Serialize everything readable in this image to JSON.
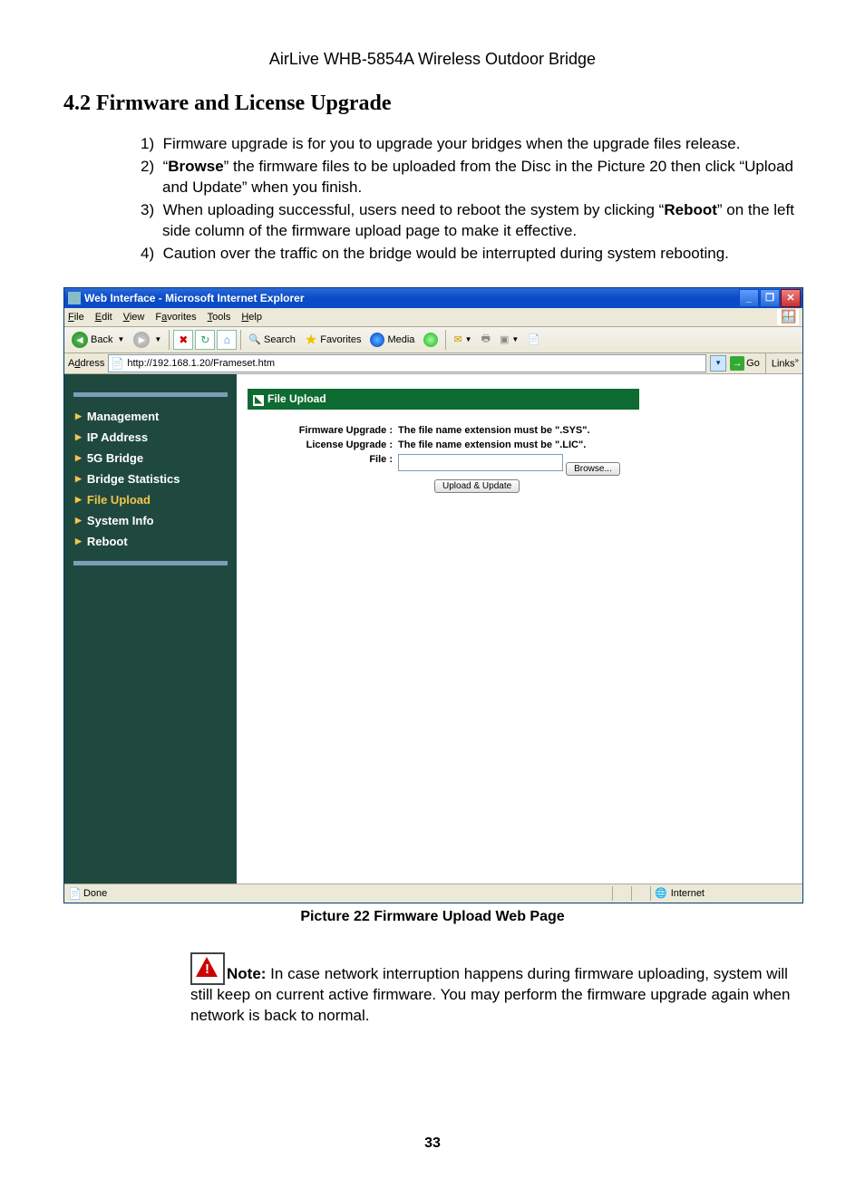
{
  "doc": {
    "header": "AirLive WHB-5854A Wireless Outdoor Bridge",
    "section_title": "4.2 Firmware and License Upgrade",
    "steps": [
      "Firmware upgrade is for you to upgrade your bridges when the upgrade files release.",
      "“<b>Browse</b>” the firmware files to be uploaded from the Disc in the Picture 20 then click “Upload and Update” when you finish.",
      "When uploading successful, users need to reboot the system by clicking “<b>Reboot</b>” on the left side column of the firmware upload page to make it effective.",
      "Caution over the traffic on the bridge would be interrupted during system rebooting."
    ],
    "caption": "Picture 22 Firmware Upload Web Page",
    "note_label": "Note:",
    "note_text": " In case network interruption happens during firmware uploading, system will still keep on current active firmware. You may perform the firmware upgrade again when network is back to normal.",
    "page_number": "33"
  },
  "ie": {
    "title": "Web Interface - Microsoft Internet Explorer",
    "menus": [
      "File",
      "Edit",
      "View",
      "Favorites",
      "Tools",
      "Help"
    ],
    "toolbar": {
      "back": "Back",
      "search": "Search",
      "favorites": "Favorites",
      "media": "Media"
    },
    "address_label": "Address",
    "url": "http://192.168.1.20/Frameset.htm",
    "go": "Go",
    "links": "Links",
    "status_done": "Done",
    "status_zone": "Internet"
  },
  "app": {
    "nav": [
      {
        "label": "Management",
        "active": false
      },
      {
        "label": "IP Address",
        "active": false
      },
      {
        "label": "5G Bridge",
        "active": false
      },
      {
        "label": "Bridge Statistics",
        "active": false
      },
      {
        "label": "File Upload",
        "active": true
      },
      {
        "label": "System Info",
        "active": false
      },
      {
        "label": "Reboot",
        "active": false
      }
    ],
    "panel_title": "File Upload",
    "firmware_label": "Firmware Upgrade :",
    "firmware_hint": "The file name extension must be \".SYS\".",
    "license_label": "License Upgrade :",
    "license_hint": "The file name extension must be \".LIC\".",
    "file_label": "File :",
    "browse": "Browse...",
    "upload": "Upload & Update"
  }
}
